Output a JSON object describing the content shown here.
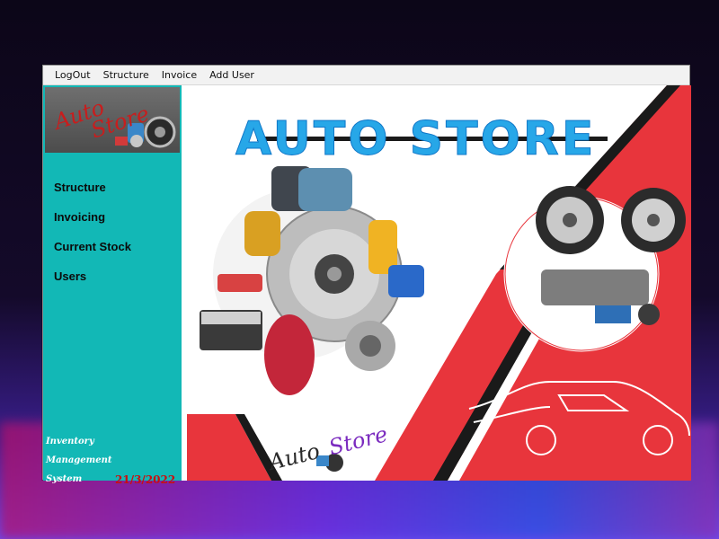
{
  "menubar": {
    "items": [
      "LogOut",
      "Structure",
      "Invoice",
      "Add User"
    ]
  },
  "sidebar": {
    "logo": {
      "line1": "Auto",
      "line2": "Store"
    },
    "items": [
      "Structure",
      "Invoicing",
      "Current Stock",
      "Users"
    ],
    "caption": {
      "line1": "Inventory",
      "line2": "Management",
      "line3": "System"
    },
    "date": "21/3/2022"
  },
  "banner": {
    "title": "AUTO STORE",
    "logo": {
      "line1": "Auto",
      "line2": "Store"
    }
  },
  "colors": {
    "sidebar": "#12b8b6",
    "banner_red": "#e8353c",
    "title_blue": "#27a7e8",
    "date_red": "#c80f0f"
  },
  "icons": [
    "car-parts-illustration",
    "wheel-illustration",
    "car-outline-illustration",
    "brake-disc-illustration"
  ]
}
